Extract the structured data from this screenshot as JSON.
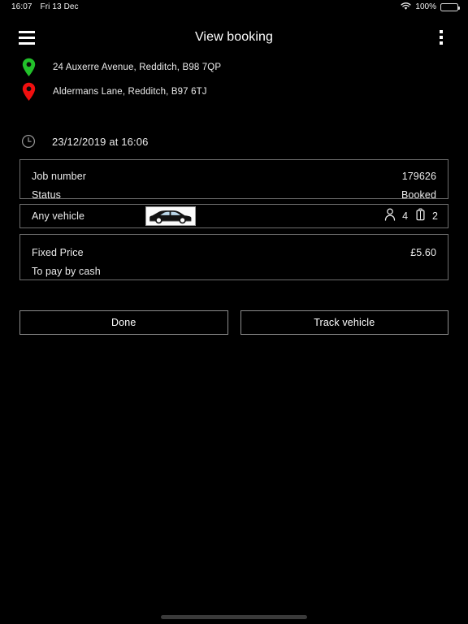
{
  "status_bar": {
    "time": "16:07",
    "date": "Fri 13 Dec",
    "battery_percent": "100%",
    "wifi_icon": "wifi-icon",
    "battery_icon": "battery-full-icon"
  },
  "app_bar": {
    "menu_icon": "hamburger-menu-icon",
    "title": "View booking",
    "overflow_icon": "overflow-menu-icon"
  },
  "addresses": [
    {
      "icon": "map-pin-pickup-icon",
      "color": "#22c02a",
      "text": "24 Auxerre Avenue, Redditch, B98 7QP"
    },
    {
      "icon": "map-pin-dropoff-icon",
      "color": "#f00f0f",
      "text": "Aldermans Lane, Redditch, B97 6TJ"
    }
  ],
  "datetime": {
    "icon": "clock-icon",
    "text": "23/12/2019 at 16:06"
  },
  "job_card": {
    "rows": [
      {
        "label": "Job number",
        "value": "179626"
      },
      {
        "label": "Status",
        "value": "Booked"
      }
    ]
  },
  "vehicle_card": {
    "name": "Any vehicle",
    "image_icon": "sedan-car-image",
    "passengers": {
      "icon": "person-icon",
      "count": "4"
    },
    "luggage": {
      "icon": "luggage-icon",
      "count": "2"
    }
  },
  "price_card": {
    "rows": [
      {
        "label": "Fixed Price",
        "value": "£5.60"
      },
      {
        "label": "To pay by cash",
        "value": ""
      }
    ]
  },
  "actions": {
    "done_label": "Done",
    "track_label": "Track vehicle"
  },
  "colors": {
    "background": "#000000",
    "text": "#ebebeb",
    "border": "#6e6e6e",
    "pickup_pin": "#22c02a",
    "dropoff_pin": "#f00f0f"
  }
}
